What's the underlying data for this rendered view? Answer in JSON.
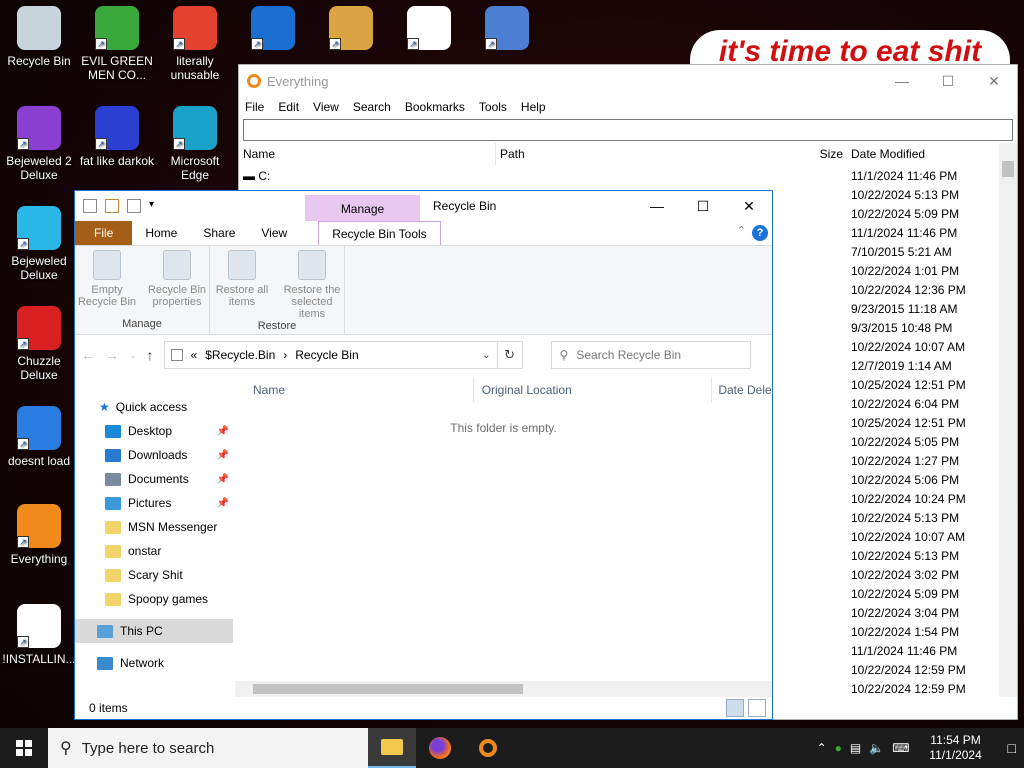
{
  "desktop": {
    "icons": [
      {
        "label": "Recycle Bin",
        "color": "#c8d4dc"
      },
      {
        "label": "EVIL GREEN MEN CO...",
        "color": "#3aa83a"
      },
      {
        "label": "literally unusable",
        "color": "#e5412f"
      },
      {
        "label": "",
        "color": "#1b6fd1"
      },
      {
        "label": "",
        "color": "#d9a441"
      },
      {
        "label": "",
        "color": "#ffffff"
      },
      {
        "label": "",
        "color": "#4a7fd4"
      },
      {
        "label": "Bejeweled 2 Deluxe",
        "color": "#8a3fd1"
      },
      {
        "label": "fat like darkok",
        "color": "#2b3fd1"
      },
      {
        "label": "Microsoft Edge",
        "color": "#1aa3c8"
      },
      {
        "label": "Bejeweled Deluxe",
        "color": "#28b7e6"
      },
      {
        "label": "Chuzzle Deluxe",
        "color": "#d82020"
      },
      {
        "label": "doesnt load",
        "color": "#2b7ce0"
      },
      {
        "label": "Everything",
        "color": "#f08a1c"
      },
      {
        "label": "!INSTALLIN...",
        "color": "#ffffff"
      }
    ],
    "banner_text": "it's time to eat shit"
  },
  "everything": {
    "title": "Everything",
    "menu": [
      "File",
      "Edit",
      "View",
      "Search",
      "Bookmarks",
      "Tools",
      "Help"
    ],
    "columns": {
      "name": "Name",
      "path": "Path",
      "size": "Size",
      "date": "Date Modified"
    },
    "first_row": "C:",
    "dates": [
      "11/1/2024 11:46 PM",
      "10/22/2024 5:13 PM",
      "10/22/2024 5:09 PM",
      "11/1/2024 11:46 PM",
      "7/10/2015 5:21 AM",
      "10/22/2024 1:01 PM",
      "10/22/2024 12:36 PM",
      "9/23/2015 11:18 AM",
      "9/3/2015 10:48 PM",
      "10/22/2024 10:07 AM",
      "12/7/2019 1:14 AM",
      "10/25/2024 12:51 PM",
      "10/22/2024 6:04 PM",
      "10/25/2024 12:51 PM",
      "10/22/2024 5:05 PM",
      "10/22/2024 1:27 PM",
      "10/22/2024 5:06 PM",
      "10/22/2024 10:24 PM",
      "10/22/2024 5:13 PM",
      "10/22/2024 10:07 AM",
      "10/22/2024 5:13 PM",
      "10/22/2024 3:02 PM",
      "10/22/2024 5:09 PM",
      "10/22/2024 3:04 PM",
      "10/22/2024 1:54 PM",
      "11/1/2024 11:46 PM",
      "10/22/2024 12:59 PM",
      "10/22/2024 12:59 PM"
    ]
  },
  "explorer": {
    "manage_tab": "Manage",
    "title": "Recycle Bin",
    "tabs": {
      "file": "File",
      "home": "Home",
      "share": "Share",
      "view": "View",
      "tools": "Recycle Bin Tools"
    },
    "ribbon": {
      "empty": "Empty Recycle Bin",
      "properties": "Recycle Bin properties",
      "group_manage": "Manage",
      "restore_all": "Restore all items",
      "restore_selected": "Restore the selected items",
      "group_restore": "Restore"
    },
    "address": {
      "root": "$Recycle.Bin",
      "current": "Recycle Bin",
      "sep": "›",
      "overflow": "«"
    },
    "search_placeholder": "Search Recycle Bin",
    "nav": {
      "quick_access": "Quick access",
      "items": [
        {
          "label": "Desktop",
          "color": "#1a8ad8",
          "pinned": true
        },
        {
          "label": "Downloads",
          "color": "#2a7ad0",
          "pinned": true
        },
        {
          "label": "Documents",
          "color": "#7a8aa0",
          "pinned": true
        },
        {
          "label": "Pictures",
          "color": "#3a9ad8",
          "pinned": true
        },
        {
          "label": "MSN Messenger",
          "color": "#f2d36b",
          "pinned": false
        },
        {
          "label": "onstar",
          "color": "#f2d36b",
          "pinned": false
        },
        {
          "label": "Scary Shit",
          "color": "#f2d36b",
          "pinned": false
        },
        {
          "label": "Spoopy games",
          "color": "#f2d36b",
          "pinned": false
        }
      ],
      "this_pc": "This PC",
      "network": "Network"
    },
    "columns": {
      "name": "Name",
      "original_location": "Original Location",
      "date_deleted": "Date Dele"
    },
    "empty_message": "This folder is empty.",
    "status": "0 items"
  },
  "taskbar": {
    "search_placeholder": "Type here to search",
    "time": "11:54 PM",
    "date": "11/1/2024"
  }
}
